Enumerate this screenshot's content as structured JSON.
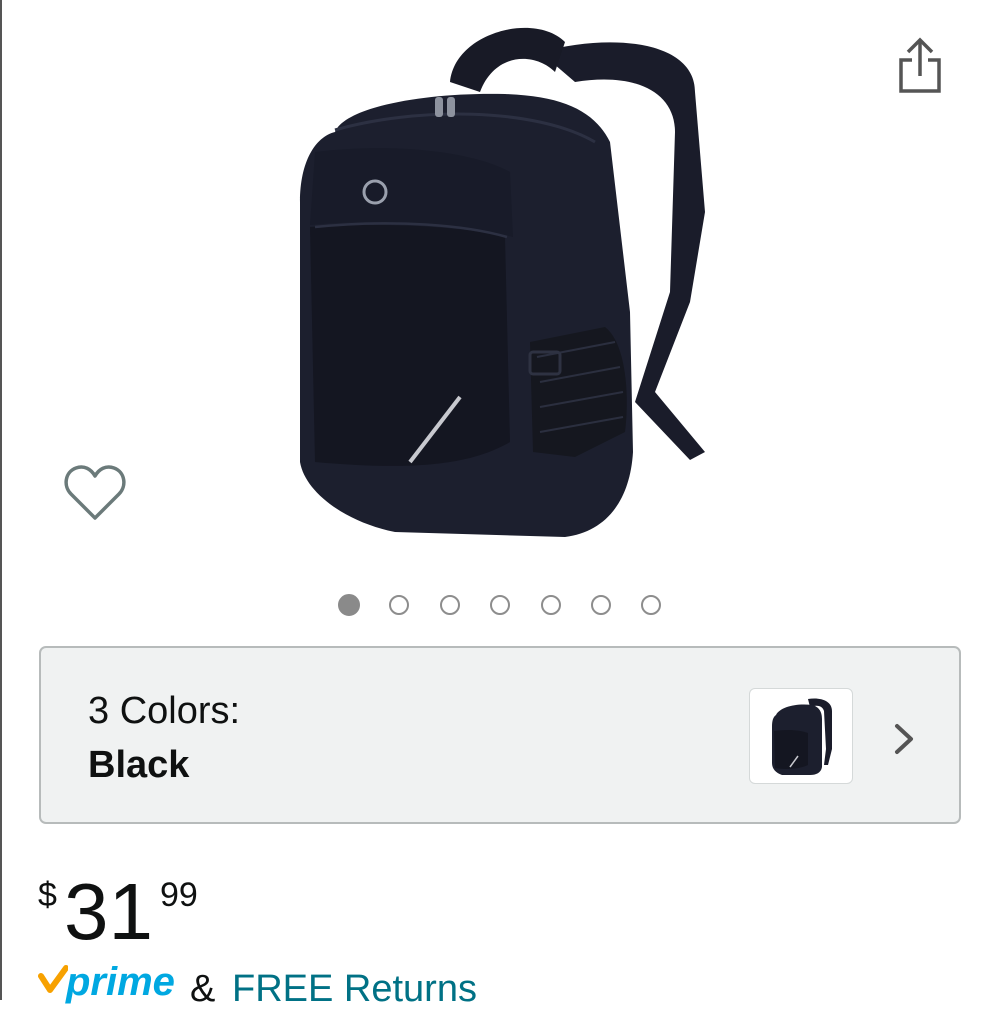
{
  "product": {
    "image_alt": "Black laptop backpack",
    "share_icon": "share-icon",
    "wishlist_icon": "heart-outline-icon",
    "carousel": {
      "total_images": 7,
      "active_index": 0
    }
  },
  "variation": {
    "label": "3 Colors:",
    "selected": "Black",
    "chevron_icon": "chevron-right-icon"
  },
  "price": {
    "currency": "$",
    "whole": "31",
    "fraction": "99"
  },
  "shipping": {
    "prime_label": "prime",
    "connector": "&",
    "returns_label": "FREE Returns"
  },
  "colors": {
    "link": "#007185",
    "prime_blue": "#00a8e1",
    "prime_check": "#f7a100",
    "card_bg": "#f0f2f2"
  }
}
